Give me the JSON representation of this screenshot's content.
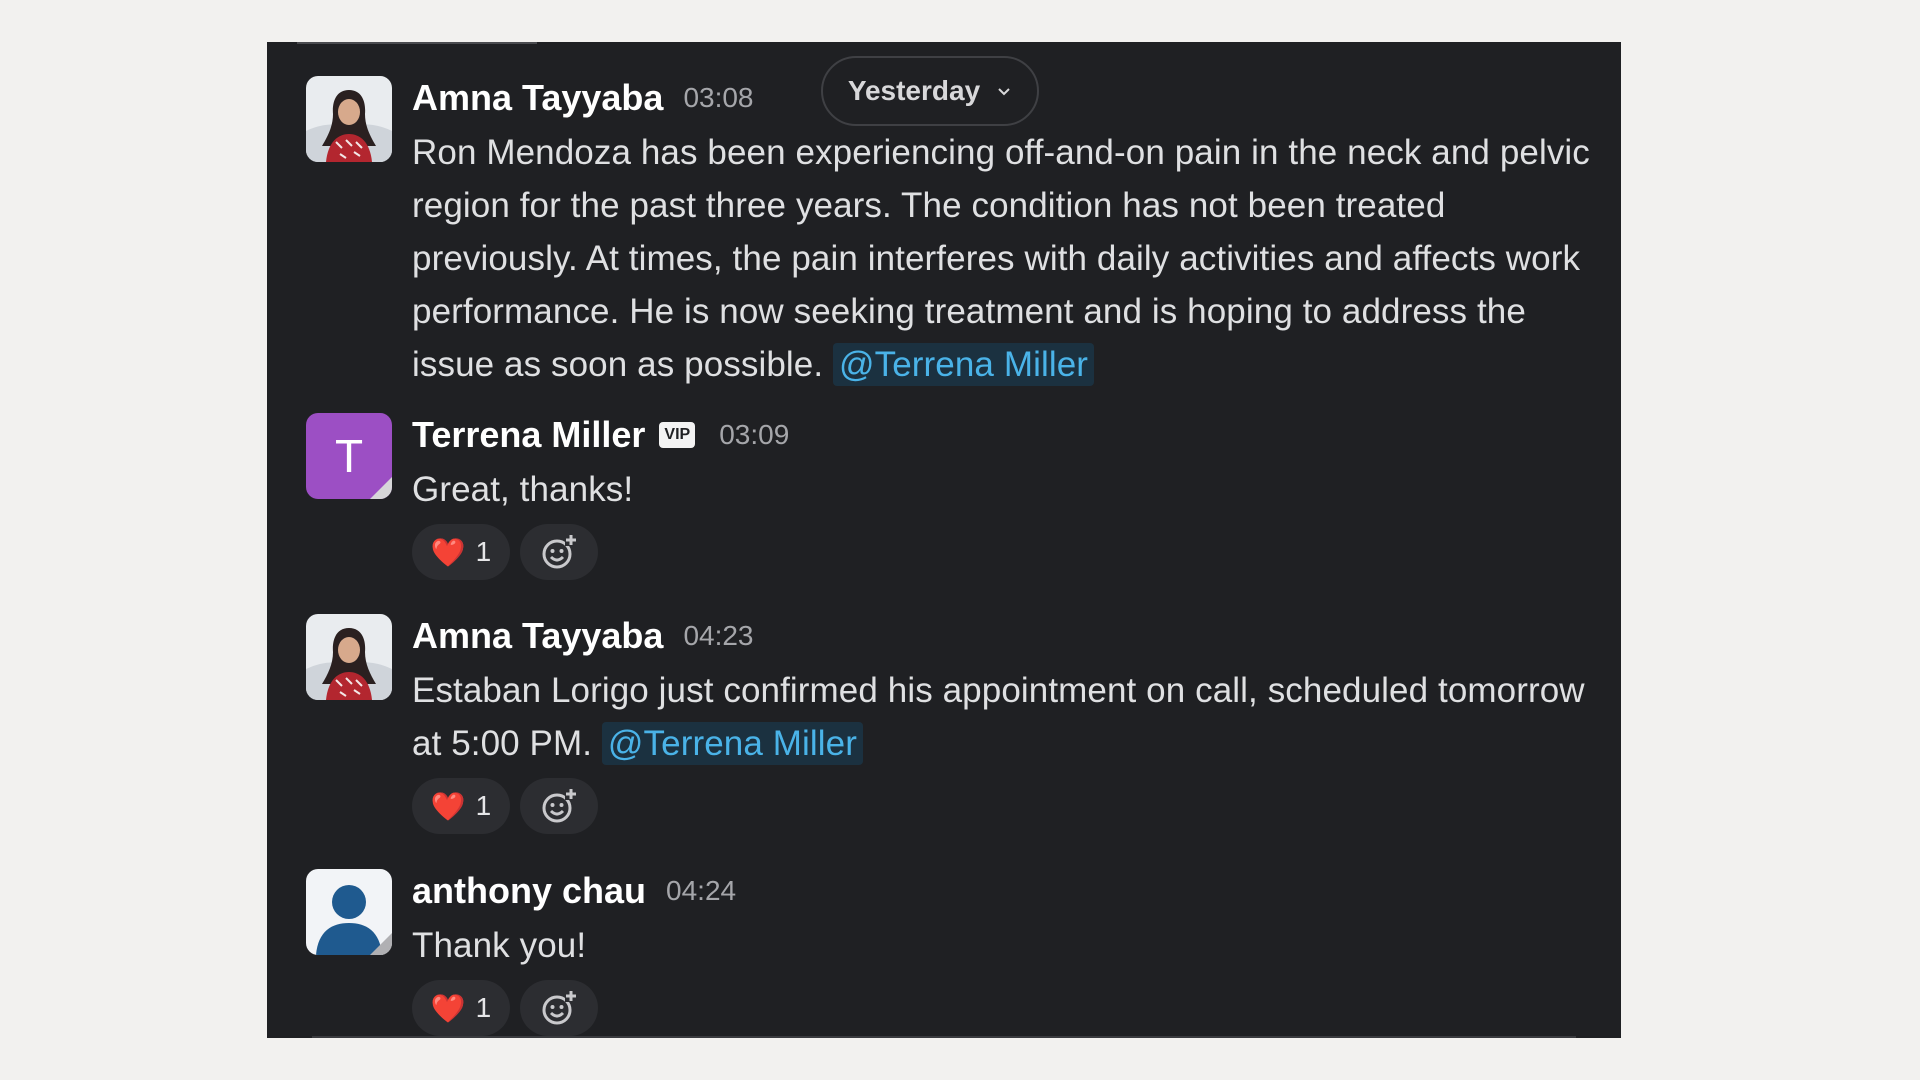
{
  "date_divider": {
    "label": "Yesterday"
  },
  "messages": [
    {
      "author": "Amna Tayyaba",
      "time": "03:08",
      "text": "Ron Mendoza has been experiencing off-and-on pain in the neck and pelvic region for the past three years. The condition has not been treated previously. At times, the pain interferes with daily activities and affects work performance. He is now seeking treatment and is hoping to address the issue as soon as possible.",
      "mention": "@Terrena Miller"
    },
    {
      "author": "Terrena Miller",
      "avatar_letter": "T",
      "badge": "VIP",
      "time": "03:09",
      "text": "Great, thanks!",
      "reaction": {
        "emoji": "❤️",
        "count": "1"
      }
    },
    {
      "author": "Amna Tayyaba",
      "time": "04:23",
      "text": "Estaban Lorigo just confirmed his appointment on call, scheduled tomorrow at 5:00 PM.",
      "mention": "@Terrena Miller",
      "reaction": {
        "emoji": "❤️",
        "count": "1"
      }
    },
    {
      "author": "anthony chau",
      "time": "04:24",
      "text": "Thank you!",
      "reaction": {
        "emoji": "❤️",
        "count": "1"
      }
    }
  ],
  "colors": {
    "panel_bg": "#1f2023",
    "mention": "#4ab3e8",
    "avatar_purple": "#9c4fc4",
    "avatar_blue": "#1f5a8f"
  },
  "icons": {
    "date_chevron": "chevron-down-icon",
    "add_reaction": "add-reaction-icon",
    "reaction_heart": "heart-icon"
  }
}
